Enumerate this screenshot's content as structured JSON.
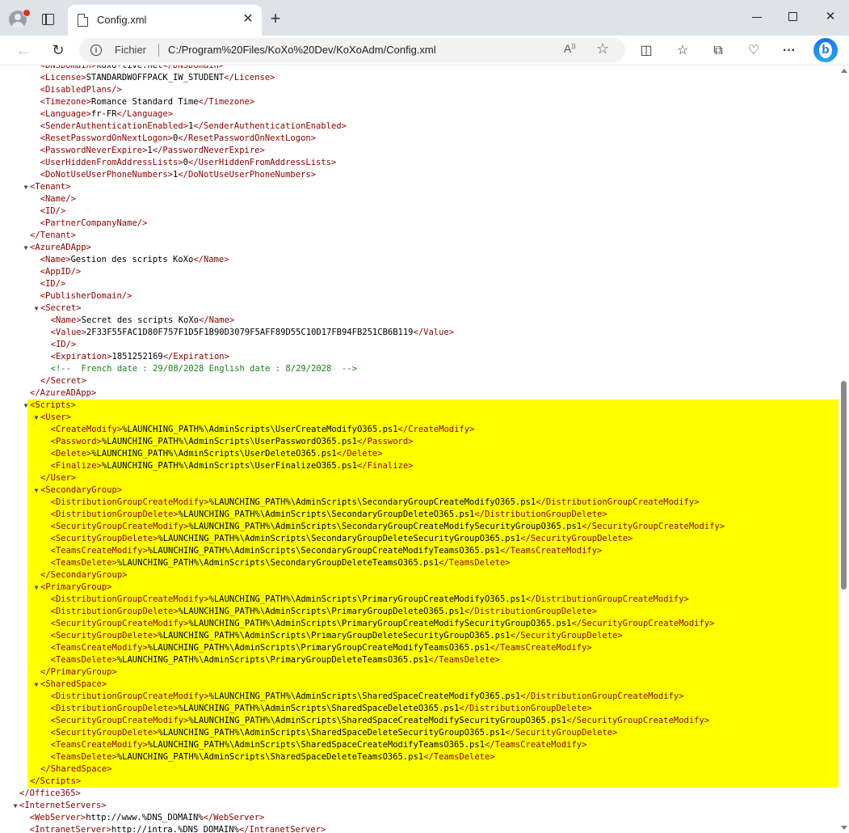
{
  "tab": {
    "title": "Config.xml"
  },
  "address": {
    "scheme_label": "Fichier",
    "url": "C:/Program%20Files/KoXo%20Dev/KoXoAdm/Config.xml"
  },
  "lines": [
    {
      "t": "  <DNSDomain>koxo-live.net</DNSDomain>"
    },
    {
      "t": "  <License>STANDARDWOFFPACK_IW_STUDENT</License>"
    },
    {
      "t": "  <DisabledPlans/>"
    },
    {
      "t": "  <Timezone>Romance Standard Time</Timezone>"
    },
    {
      "t": "  <Language>fr-FR</Language>"
    },
    {
      "t": "  <SenderAuthenticationEnabled>1</SenderAuthenticationEnabled>"
    },
    {
      "t": "  <ResetPasswordOnNextLogon>0</ResetPasswordOnNextLogon>"
    },
    {
      "t": "  <PasswordNeverExpire>1</PasswordNeverExpire>"
    },
    {
      "t": "  <UserHiddenFromAddressLists>0</UserHiddenFromAddressLists>"
    },
    {
      "t": "  <DoNotUseUserPhoneNumbers>1</DoNotUseUserPhoneNumbers>"
    },
    {
      "t": "<Tenant>",
      "tw": true,
      "i": 1
    },
    {
      "t": "  <Name/>",
      "i": 1
    },
    {
      "t": "  <ID/>",
      "i": 1
    },
    {
      "t": "  <PartnerCompanyName/>",
      "i": 1
    },
    {
      "t": "</Tenant>",
      "i": 1
    },
    {
      "t": "<AzureADApp>",
      "tw": true,
      "i": 1
    },
    {
      "t": "  <Name>Gestion des scripts KoXo</Name>",
      "i": 1
    },
    {
      "t": "  <AppID/>",
      "i": 1
    },
    {
      "t": "  <ID/>",
      "i": 1
    },
    {
      "t": "  <PublisherDomain/>",
      "i": 1
    },
    {
      "t": "<Secret>",
      "tw": true,
      "i": 2
    },
    {
      "t": "  <Name>Secret des scripts KoXo</Name>",
      "i": 2
    },
    {
      "t": "  <Value>2F33F55FAC1D80F757F1D5F1B90D3079F5AFF89D55C10D17FB94FB251CB6B119</Value>",
      "i": 2
    },
    {
      "t": "  <ID/>",
      "i": 2
    },
    {
      "t": "  <Expiration>1851252169</Expiration>",
      "i": 2
    },
    {
      "t": "  <!--  French date : 29/08/2028 English date : 8/29/2028  -->",
      "i": 2,
      "c": true
    },
    {
      "t": "</Secret>",
      "i": 2
    },
    {
      "t": "</AzureADApp>",
      "i": 1
    },
    {
      "t": "<Scripts>",
      "tw": true,
      "i": 1,
      "h": true
    },
    {
      "t": "<User>",
      "tw": true,
      "i": 2,
      "h": true
    },
    {
      "t": "  <CreateModify>%LAUNCHING_PATH%\\AdminScripts\\UserCreateModifyO365.ps1</CreateModify>",
      "i": 2,
      "h": true
    },
    {
      "t": "  <Password>%LAUNCHING_PATH%\\AdminScripts\\UserPasswordO365.ps1</Password>",
      "i": 2,
      "h": true
    },
    {
      "t": "  <Delete>%LAUNCHING_PATH%\\AdminScripts\\UserDeleteO365.ps1</Delete>",
      "i": 2,
      "h": true
    },
    {
      "t": "  <Finalize>%LAUNCHING_PATH%\\AdminScripts\\UserFinalizeO365.ps1</Finalize>",
      "i": 2,
      "h": true
    },
    {
      "t": "</User>",
      "i": 2,
      "h": true
    },
    {
      "t": "<SecondaryGroup>",
      "tw": true,
      "i": 2,
      "h": true
    },
    {
      "t": "  <DistributionGroupCreateModify>%LAUNCHING_PATH%\\AdminScripts\\SecondaryGroupCreateModifyO365.ps1</DistributionGroupCreateModify>",
      "i": 2,
      "h": true
    },
    {
      "t": "  <DistributionGroupDelete>%LAUNCHING_PATH%\\AdminScripts\\SecondaryGroupDeleteO365.ps1</DistributionGroupDelete>",
      "i": 2,
      "h": true
    },
    {
      "t": "  <SecurityGroupCreateModify>%LAUNCHING_PATH%\\AdminScripts\\SecondaryGroupCreateModifySecurityGroupO365.ps1</SecurityGroupCreateModify>",
      "i": 2,
      "h": true
    },
    {
      "t": "  <SecurityGroupDelete>%LAUNCHING_PATH%\\AdminScripts\\SecondaryGroupDeleteSecurityGroupO365.ps1</SecurityGroupDelete>",
      "i": 2,
      "h": true
    },
    {
      "t": "  <TeamsCreateModify>%LAUNCHING_PATH%\\AdminScripts\\SecondaryGroupCreateModifyTeamsO365.ps1</TeamsCreateModify>",
      "i": 2,
      "h": true
    },
    {
      "t": "  <TeamsDelete>%LAUNCHING_PATH%\\AdminScripts\\SecondaryGroupDeleteTeamsO365.ps1</TeamsDelete>",
      "i": 2,
      "h": true
    },
    {
      "t": "</SecondaryGroup>",
      "i": 2,
      "h": true
    },
    {
      "t": "<PrimaryGroup>",
      "tw": true,
      "i": 2,
      "h": true
    },
    {
      "t": "  <DistributionGroupCreateModify>%LAUNCHING_PATH%\\AdminScripts\\PrimaryGroupCreateModifyO365.ps1</DistributionGroupCreateModify>",
      "i": 2,
      "h": true
    },
    {
      "t": "  <DistributionGroupDelete>%LAUNCHING_PATH%\\AdminScripts\\PrimaryGroupDeleteO365.ps1</DistributionGroupDelete>",
      "i": 2,
      "h": true
    },
    {
      "t": "  <SecurityGroupCreateModify>%LAUNCHING_PATH%\\AdminScripts\\PrimaryGroupCreateModifySecurityGroupO365.ps1</SecurityGroupCreateModify>",
      "i": 2,
      "h": true
    },
    {
      "t": "  <SecurityGroupDelete>%LAUNCHING_PATH%\\AdminScripts\\PrimaryGroupDeleteSecurityGroupO365.ps1</SecurityGroupDelete>",
      "i": 2,
      "h": true
    },
    {
      "t": "  <TeamsCreateModify>%LAUNCHING_PATH%\\AdminScripts\\PrimaryGroupCreateModifyTeamsO365.ps1</TeamsCreateModify>",
      "i": 2,
      "h": true
    },
    {
      "t": "  <TeamsDelete>%LAUNCHING_PATH%\\AdminScripts\\PrimaryGroupDeleteTeamsO365.ps1</TeamsDelete>",
      "i": 2,
      "h": true
    },
    {
      "t": "</PrimaryGroup>",
      "i": 2,
      "h": true
    },
    {
      "t": "<SharedSpace>",
      "tw": true,
      "i": 2,
      "h": true
    },
    {
      "t": "  <DistributionGroupCreateModify>%LAUNCHING_PATH%\\AdminScripts\\SharedSpaceCreateModifyO365.ps1</DistributionGroupCreateModify>",
      "i": 2,
      "h": true
    },
    {
      "t": "  <DistributionGroupDelete>%LAUNCHING_PATH%\\AdminScripts\\SharedSpaceDeleteO365.ps1</DistributionGroupDelete>",
      "i": 2,
      "h": true
    },
    {
      "t": "  <SecurityGroupCreateModify>%LAUNCHING_PATH%\\AdminScripts\\SharedSpaceCreateModifySecurityGroupO365.ps1</SecurityGroupCreateModify>",
      "i": 2,
      "h": true
    },
    {
      "t": "  <SecurityGroupDelete>%LAUNCHING_PATH%\\AdminScripts\\SharedSpaceDeleteSecurityGroupO365.ps1</SecurityGroupDelete>",
      "i": 2,
      "h": true
    },
    {
      "t": "  <TeamsCreateModify>%LAUNCHING_PATH%\\AdminScripts\\SharedSpaceCreateModifyTeamsO365.ps1</TeamsCreateModify>",
      "i": 2,
      "h": true
    },
    {
      "t": "  <TeamsDelete>%LAUNCHING_PATH%\\AdminScripts\\SharedSpaceDeleteTeamsO365.ps1</TeamsDelete>",
      "i": 2,
      "h": true
    },
    {
      "t": "</SharedSpace>",
      "i": 2,
      "h": true
    },
    {
      "t": "</Scripts>",
      "i": 1,
      "h": true
    },
    {
      "t": "</Office365>",
      "i": 0
    },
    {
      "t": "<InternetServers>",
      "tw": true,
      "i": 0
    },
    {
      "t": "  <WebServer>http://www.%DNS_DOMAIN%</WebServer>",
      "i": 0
    },
    {
      "t": "  <IntranetServer>http://intra.%DNS_DOMAIN%</IntranetServer>",
      "i": 0
    }
  ]
}
